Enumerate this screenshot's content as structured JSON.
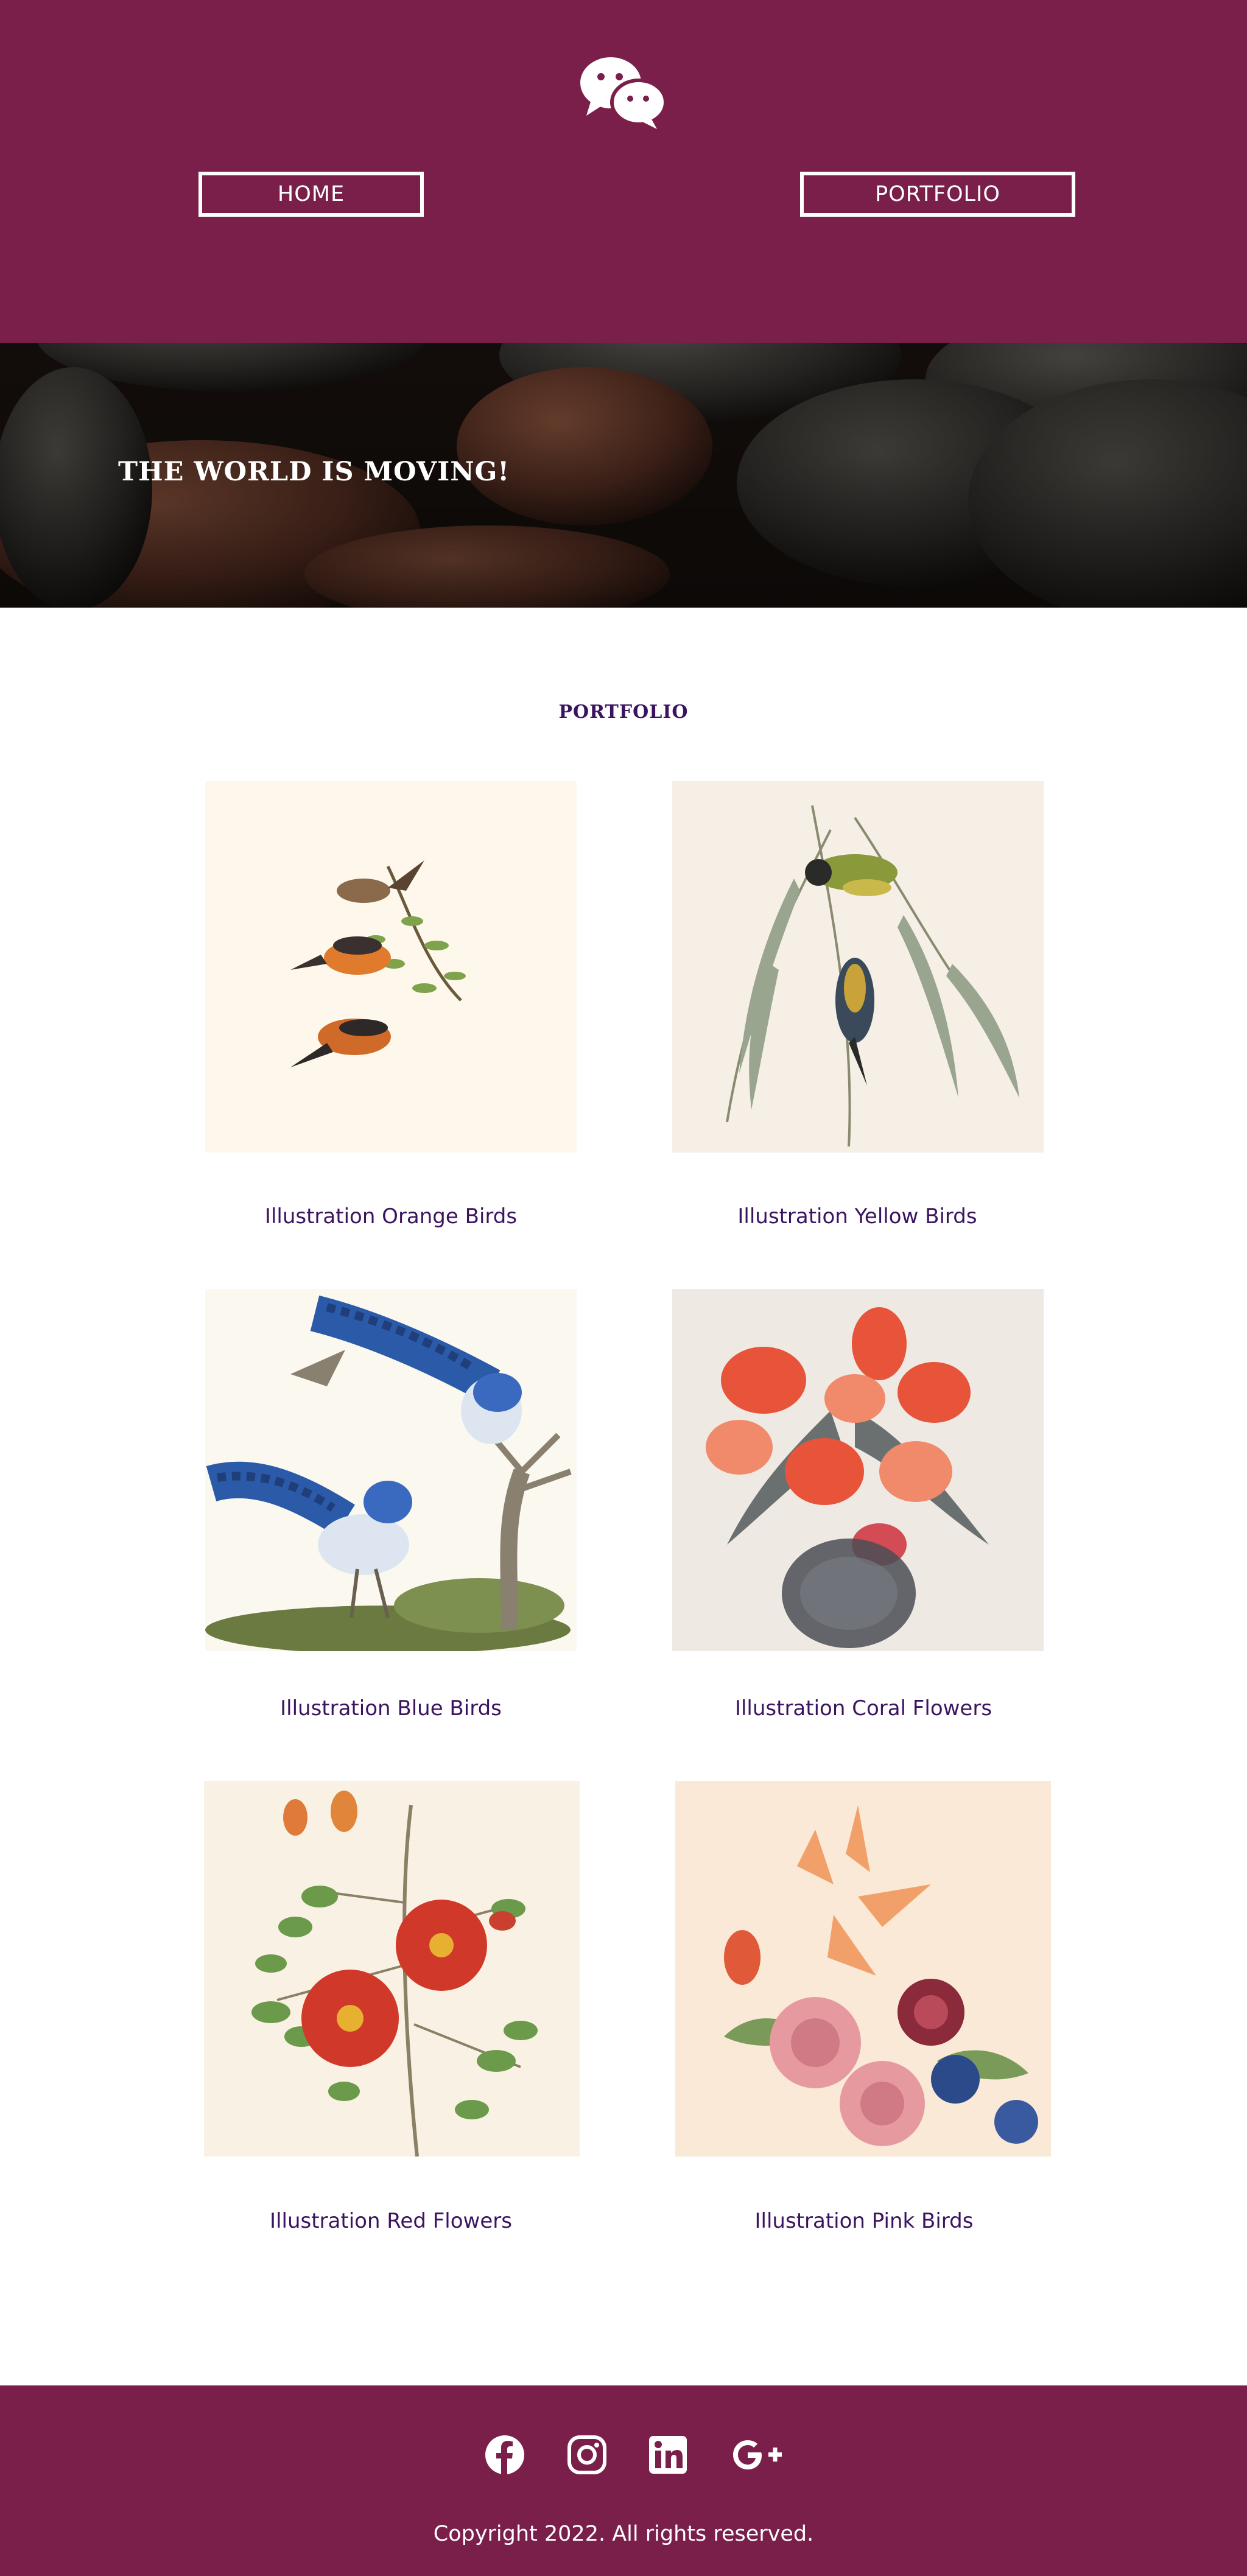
{
  "header": {
    "logo_icon": "wechat-icon",
    "nav": {
      "home_label": "HOME",
      "portfolio_label": "PORTFOLIO"
    }
  },
  "hero": {
    "title": "THE WORLD IS MOVING!"
  },
  "portfolio": {
    "title": "PORTFOLIO",
    "items": [
      {
        "caption": "Illustration Orange Birds"
      },
      {
        "caption": "Illustration Yellow Birds"
      },
      {
        "caption": "Illustration Blue Birds"
      },
      {
        "caption": "Illustration Coral Flowers"
      },
      {
        "caption": "Illustration Red Flowers"
      },
      {
        "caption": "Illustration Pink Birds"
      }
    ]
  },
  "footer": {
    "social_icons": [
      "facebook-icon",
      "instagram-icon",
      "linkedin-icon",
      "google-plus-icon"
    ],
    "copyright": "Copyright 2022. All rights reserved."
  },
  "colors": {
    "brand": "#7a1f4a",
    "accent_text": "#3b1460"
  }
}
